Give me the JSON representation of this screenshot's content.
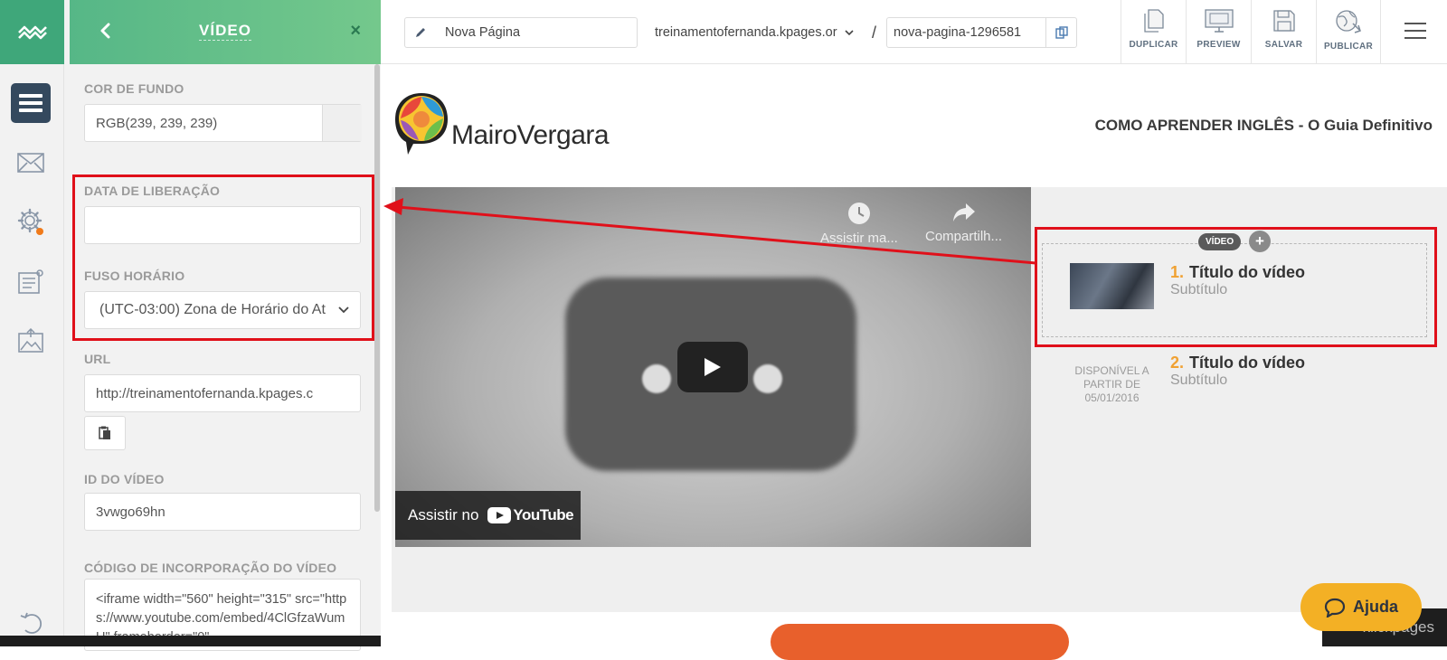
{
  "panel": {
    "title": "VÍDEO",
    "close_label": "×",
    "bg_color_label": "COR DE FUNDO",
    "bg_color_value": "RGB(239, 239, 239)",
    "release_date_label": "DATA DE LIBERAÇÃO",
    "release_date_value": "",
    "timezone_label": "FUSO HORÁRIO",
    "timezone_value": "(UTC-03:00) Zona de Horário do At",
    "url_label": "URL",
    "url_value": "http://treinamentofernanda.kpages.c",
    "video_id_label": "ID DO VÍDEO",
    "video_id_value": "3vwgo69hn",
    "embed_label": "CÓDIGO DE INCORPORAÇÃO DO VÍDEO",
    "embed_value": "<iframe width=\"560\" height=\"315\" src=\"https://www.youtube.com/embed/4ClGfzaWumU\" frameborder=\"0\""
  },
  "topbar": {
    "page_name": "Nova Página",
    "domain": "treinamentofernanda.kpages.or",
    "slash": "/",
    "slug": "nova-pagina-1296581",
    "tools": [
      "DUPLICAR",
      "PREVIEW",
      "SALVAR",
      "PUBLICAR"
    ]
  },
  "page": {
    "brand": "MairoVergara",
    "header_title": "COMO APRENDER INGLÊS - O Guia Definitivo",
    "badge": "VÍDEO",
    "plus": "+",
    "youtube": {
      "watch_later": "Assistir ma...",
      "share": "Compartilh...",
      "watch_on": "Assistir no",
      "logo_text": "YouTube"
    },
    "videos": [
      {
        "num": "1.",
        "title": "Título do vídeo",
        "subtitle": "Subtítulo"
      },
      {
        "num": "2.",
        "title": "Título do vídeo",
        "subtitle": "Subtítulo",
        "availability": "DISPONÍVEL A PARTIR DE 05/01/2016"
      }
    ]
  },
  "help": {
    "label": "Ajuda",
    "watermark": "klickpages"
  },
  "colors": {
    "accent_green": "#56b787",
    "annotation_red": "#e0101a",
    "help_yellow": "#f3b025",
    "number_orange": "#f0a132"
  }
}
